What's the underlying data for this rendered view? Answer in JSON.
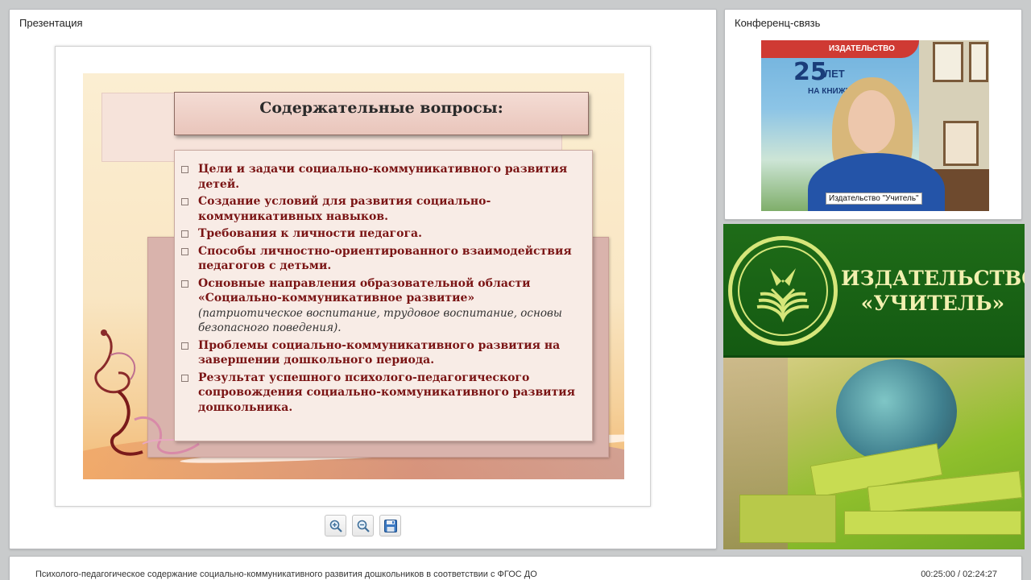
{
  "presentation": {
    "panel_title": "Презентация",
    "slide": {
      "title": "Содержательные вопросы:",
      "bullets": [
        {
          "text": "Цели и задачи социально-коммуникативного развития детей.",
          "note": ""
        },
        {
          "text": "Создание  условий для развития социально-коммуникативных навыков.",
          "note": ""
        },
        {
          "text": "Требования к личности педагога.",
          "note": ""
        },
        {
          "text": "Способы личностно-ориентированного взаимодействия педагогов с детьми.",
          "note": ""
        },
        {
          "text": "Основные направления образовательной области «Социально-коммуникативное развитие»",
          "note": "(патриотическое воспитание, трудовое воспитание, основы безопасного поведения)."
        },
        {
          "text": "Проблемы социально-коммуникативного развития на завершении дошкольного периода.",
          "note": ""
        },
        {
          "text": "Результат  успешного  психолого-педагогического сопровождения социально-коммуникативного развития дошкольника.",
          "note": ""
        }
      ]
    },
    "tools": {
      "zoom_in": "zoom-in-icon",
      "zoom_out": "zoom-out-icon",
      "save": "save-icon"
    }
  },
  "conference": {
    "panel_title": "Конференц-связь",
    "banner": {
      "publisher": "ИЗДАТЕЛЬСТВО",
      "years": "25",
      "years_word": "ЛЕТ",
      "market": "НА КНИЖНО"
    },
    "speaker_caption": "Издательство \"Учитель\""
  },
  "ad": {
    "line1": "ИЗДАТЕЛЬСТВО",
    "line2": "«УЧИТЕЛЬ»",
    "colors": {
      "green": "#1f6c18",
      "text": "#f2f0b0"
    }
  },
  "bottom_bar": {
    "title": "Психолого-педагогическое содержание социально-коммуникативного развития дошкольников в соответствии с ФГОС ДО",
    "time": "00:25:00 / 02:24:27"
  }
}
